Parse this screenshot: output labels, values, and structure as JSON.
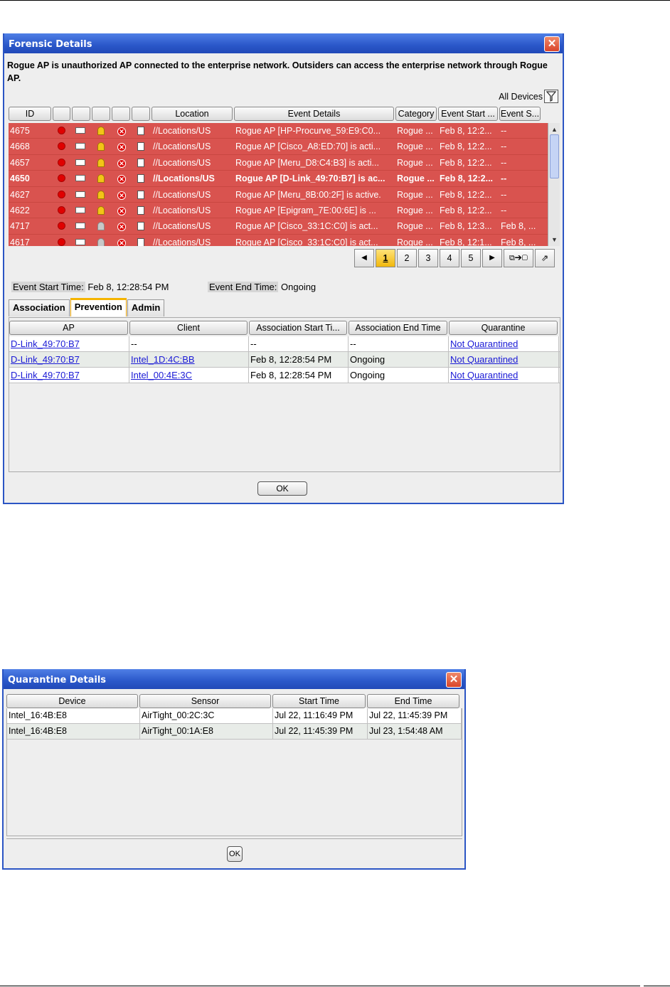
{
  "forensic": {
    "title": "Forensic Details",
    "close_label": "✕",
    "description": "Rogue AP is unauthorized AP connected to the enterprise network. Outsiders can access the enterprise network through Rogue AP.",
    "filter_label": "All Devices",
    "columns": [
      "ID",
      "",
      "",
      "",
      "",
      "",
      "Location",
      "Event Details",
      "Category",
      "Event Start ...",
      "Event S..."
    ],
    "rows": [
      {
        "id": "4675",
        "bell": "yellow",
        "location": "//Locations/US",
        "details": "Rogue AP [HP-Procurve_59:E9:C0...",
        "category": "Rogue ...",
        "start": "Feb 8, 12:2...",
        "end": "--",
        "bold": false
      },
      {
        "id": "4668",
        "bell": "yellow",
        "location": "//Locations/US",
        "details": "Rogue AP [Cisco_A8:ED:70] is acti...",
        "category": "Rogue ...",
        "start": "Feb 8, 12:2...",
        "end": "--",
        "bold": false
      },
      {
        "id": "4657",
        "bell": "yellow",
        "location": "//Locations/US",
        "details": "Rogue AP [Meru_D8:C4:B3] is acti...",
        "category": "Rogue ...",
        "start": "Feb 8, 12:2...",
        "end": "--",
        "bold": false
      },
      {
        "id": "4650",
        "bell": "yellow",
        "location": "//Locations/US",
        "details": "Rogue AP [D-Link_49:70:B7] is ac...",
        "category": "Rogue ...",
        "start": "Feb 8, 12:2...",
        "end": "--",
        "bold": true
      },
      {
        "id": "4627",
        "bell": "yellow",
        "location": "//Locations/US",
        "details": "Rogue AP [Meru_8B:00:2F] is active.",
        "category": "Rogue ...",
        "start": "Feb 8, 12:2...",
        "end": "--",
        "bold": false
      },
      {
        "id": "4622",
        "bell": "yellow",
        "location": "//Locations/US",
        "details": "Rogue AP [Epigram_7E:00:6E] is ...",
        "category": "Rogue ...",
        "start": "Feb 8, 12:2...",
        "end": "--",
        "bold": false
      },
      {
        "id": "4717",
        "bell": "grey",
        "location": "//Locations/US",
        "details": "Rogue AP [Cisco_33:1C:C0] is act...",
        "category": "Rogue ...",
        "start": "Feb 8, 12:3...",
        "end": "Feb 8, ...",
        "bold": false
      },
      {
        "id": "4617",
        "bell": "grey",
        "location": "//Locations/US",
        "details": "Rogue AP [Cisco_33:1C:C0] is act...",
        "category": "Rogue ...",
        "start": "Feb 8, 12:1...",
        "end": "Feb 8, ...",
        "bold": false
      }
    ],
    "pager": {
      "prev": "◀",
      "pages": [
        "1",
        "2",
        "3",
        "4",
        "5"
      ],
      "active": "1",
      "next": "▶",
      "export_icon": "⧉➔▢",
      "popout_icon": "⇗"
    },
    "event_start_label": "Event Start Time:",
    "event_start_value": "Feb 8, 12:28:54 PM",
    "event_end_label": "Event End Time:",
    "event_end_value": "Ongoing",
    "tabs": [
      "Association",
      "Prevention",
      "Admin"
    ],
    "active_tab": "Prevention",
    "prevention_columns": [
      "AP",
      "Client",
      "Association Start Ti...",
      "Association End Time",
      "Quarantine"
    ],
    "prevention_rows": [
      {
        "ap": "D-Link_49:70:B7",
        "client": "--",
        "start": "--",
        "end": "--",
        "quarantine": "Not Quarantined"
      },
      {
        "ap": "D-Link_49:70:B7",
        "client": "Intel_1D:4C:BB",
        "start": "Feb 8, 12:28:54 PM",
        "end": "Ongoing",
        "quarantine": "Not Quarantined"
      },
      {
        "ap": "D-Link_49:70:B7",
        "client": "Intel_00:4E:3C",
        "start": "Feb 8, 12:28:54 PM",
        "end": "Ongoing",
        "quarantine": "Not Quarantined"
      }
    ],
    "ok_label": "OK"
  },
  "quarantine": {
    "title": "Quarantine Details",
    "close_label": "✕",
    "columns": [
      "Device",
      "Sensor",
      "Start Time",
      "End Time"
    ],
    "rows": [
      {
        "device": "Intel_16:4B:E8",
        "sensor": "AirTight_00:2C:3C",
        "start": "Jul 22, 11:16:49 PM",
        "end": "Jul 22, 11:45:39 PM"
      },
      {
        "device": "Intel_16:4B:E8",
        "sensor": "AirTight_00:1A:E8",
        "start": "Jul 22, 11:45:39 PM",
        "end": "Jul 23, 1:54:48 AM"
      }
    ],
    "ok_label": "OK"
  },
  "colors": {
    "title_bar": "#2a57c9",
    "alert_row": "#d9534f",
    "active_tab": "#f5b400",
    "active_page": "#f1b80c",
    "link": "#1a1ad6"
  }
}
